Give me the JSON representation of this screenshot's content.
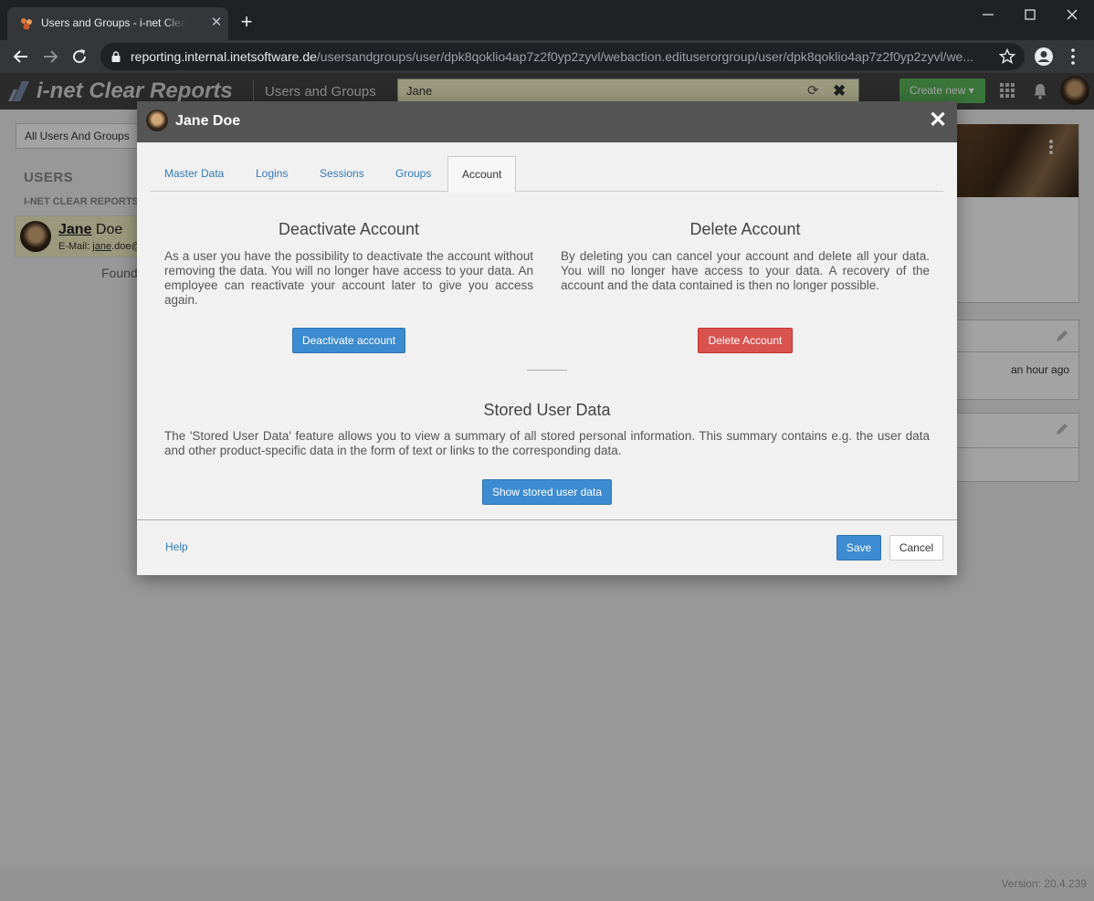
{
  "browser": {
    "tab_title": "Users and Groups - i-net Clear Reports",
    "url_host": "reporting.internal.inetsoftware.de",
    "url_path": "/usersandgroups/user/dpk8qoklio4ap7z2f0yp2zyvl/webaction.edituserorgroup/user/dpk8qoklio4ap7z2f0yp2zyvl/we..."
  },
  "app": {
    "logo_text": "i-net Clear Reports",
    "section": "Users and Groups",
    "search_value": "Jane",
    "create_new_label": "Create new ▾",
    "version": "Version: 20.4.239"
  },
  "sidebar": {
    "filter_label": "All Users And Groups",
    "users_heading": "USERS",
    "group_heading": "I-NET CLEAR REPORTS",
    "user": {
      "first_name": "Jane",
      "last_name": " Doe",
      "email_label": "E-Mail: ",
      "email_user": "jane",
      "email_rest": ".doe@"
    },
    "found_text": "Found"
  },
  "right_panel": {
    "last_activity": "an hour ago"
  },
  "dialog": {
    "title": "Jane Doe",
    "tabs": [
      {
        "label": "Master Data"
      },
      {
        "label": "Logins"
      },
      {
        "label": "Sessions"
      },
      {
        "label": "Groups"
      },
      {
        "label": "Account"
      }
    ],
    "active_tab": "Account",
    "deactivate": {
      "title": "Deactivate Account",
      "text": "As a user you have the possibility to deactivate the account without removing the data. You will no longer have access to your data. An employee can reactivate your account later to give you access again.",
      "button": "Deactivate account"
    },
    "delete": {
      "title": "Delete Account",
      "text": "By deleting you can cancel your account and delete all your data. You will no longer have access to your data. A recovery of the account and the data contained is then no longer possible.",
      "button": "Delete Account"
    },
    "stored": {
      "title": "Stored User Data",
      "text": "The 'Stored User Data' feature allows you to view a summary of all stored personal information. This summary contains e.g. the user data and other product-specific data in the form of text or links to the corresponding data.",
      "button": "Show stored user data"
    },
    "footer": {
      "help": "Help",
      "save": "Save",
      "cancel": "Cancel"
    }
  },
  "colors": {
    "primary": "#3d8bd0",
    "danger": "#d9534f",
    "success": "#5cb85c",
    "header": "#555555"
  }
}
